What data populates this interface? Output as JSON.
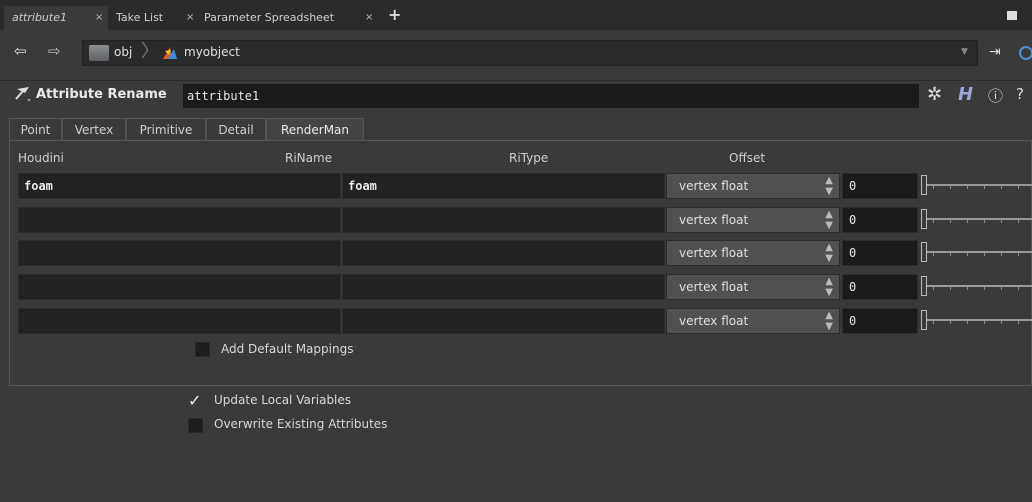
{
  "tabs": [
    {
      "label": "attribute1",
      "active": true
    },
    {
      "label": "Take List",
      "active": false
    },
    {
      "label": "Parameter Spreadsheet",
      "active": false
    }
  ],
  "path": {
    "items": [
      "obj",
      "myobject"
    ]
  },
  "node": {
    "type_label": "Attribute Rename",
    "name": "attribute1"
  },
  "subtabs": [
    "Point",
    "Vertex",
    "Primitive",
    "Detail",
    "RenderMan"
  ],
  "selected_subtab": "RenderMan",
  "columns": {
    "houdini": "Houdini",
    "riname": "RiName",
    "ritype": "RiType",
    "offset": "Offset"
  },
  "rows": [
    {
      "houdini": "foam",
      "riname": "foam",
      "ritype": "vertex float",
      "offset": "0"
    },
    {
      "houdini": "",
      "riname": "",
      "ritype": "vertex float",
      "offset": "0"
    },
    {
      "houdini": "",
      "riname": "",
      "ritype": "vertex float",
      "offset": "0"
    },
    {
      "houdini": "",
      "riname": "",
      "ritype": "vertex float",
      "offset": "0"
    },
    {
      "houdini": "",
      "riname": "",
      "ritype": "vertex float",
      "offset": "0"
    }
  ],
  "add_default_mappings": {
    "label": "Add Default Mappings",
    "checked": false
  },
  "update_local_variables": {
    "label": "Update Local Variables",
    "checked": true
  },
  "overwrite_existing": {
    "label": "Overwrite Existing Attributes",
    "checked": false
  },
  "colors": {
    "accent": "#4a90d9",
    "background": "#3a3a3a",
    "field": "#222222"
  }
}
